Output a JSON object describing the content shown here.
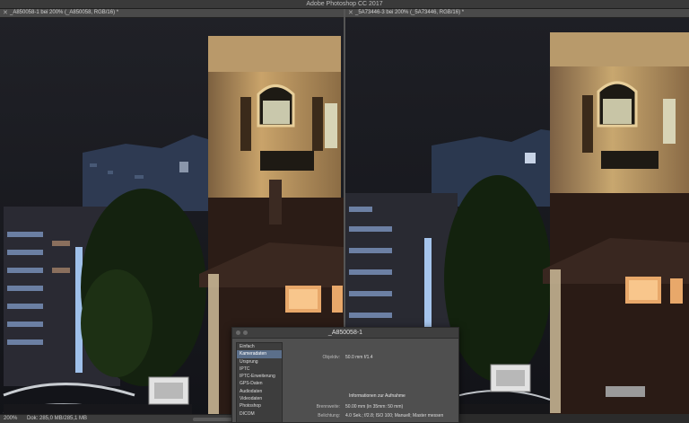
{
  "app": {
    "title": "Adobe Photoshop CC 2017"
  },
  "documents": [
    {
      "tab_title": "_A850058-1 bei 200% (_A850058, RGB/16) *"
    },
    {
      "tab_title": "_5A73446-3 bei 200% (_5A73446, RGB/16) *"
    }
  ],
  "status": {
    "zoom": "200%",
    "doc": "Dok: 285,0 MB/285,1 MB"
  },
  "dialog": {
    "title": "_A850058-1",
    "categories": [
      "Einfach",
      "Kameradaten",
      "Ursprung",
      "IPTC",
      "IPTC-Erweiterung",
      "GPS-Daten",
      "Audiodaten",
      "Videodaten",
      "Photoshop",
      "DICOM"
    ],
    "selected_category": "Kameradaten",
    "fields": {
      "objektiv_label": "Objektiv:",
      "objektiv_value": "50.0 mm f/1.4",
      "section_heading": "Informationen zur Aufnahme",
      "brennweite_label": "Brennweite:",
      "brennweite_value": "50.00 mm (in 35mm: 50 mm)",
      "belichtung_label": "Belichtung:",
      "belichtung_value": "4.0 Sek.; f/2.8; ISO 100; Manuell; Master messen"
    }
  },
  "colors": {
    "night_sky": "#1a1b21",
    "lamp_glow": "#f2cc7e",
    "facade": "#9b7a4d",
    "window_blue": "#7fa6d9"
  }
}
